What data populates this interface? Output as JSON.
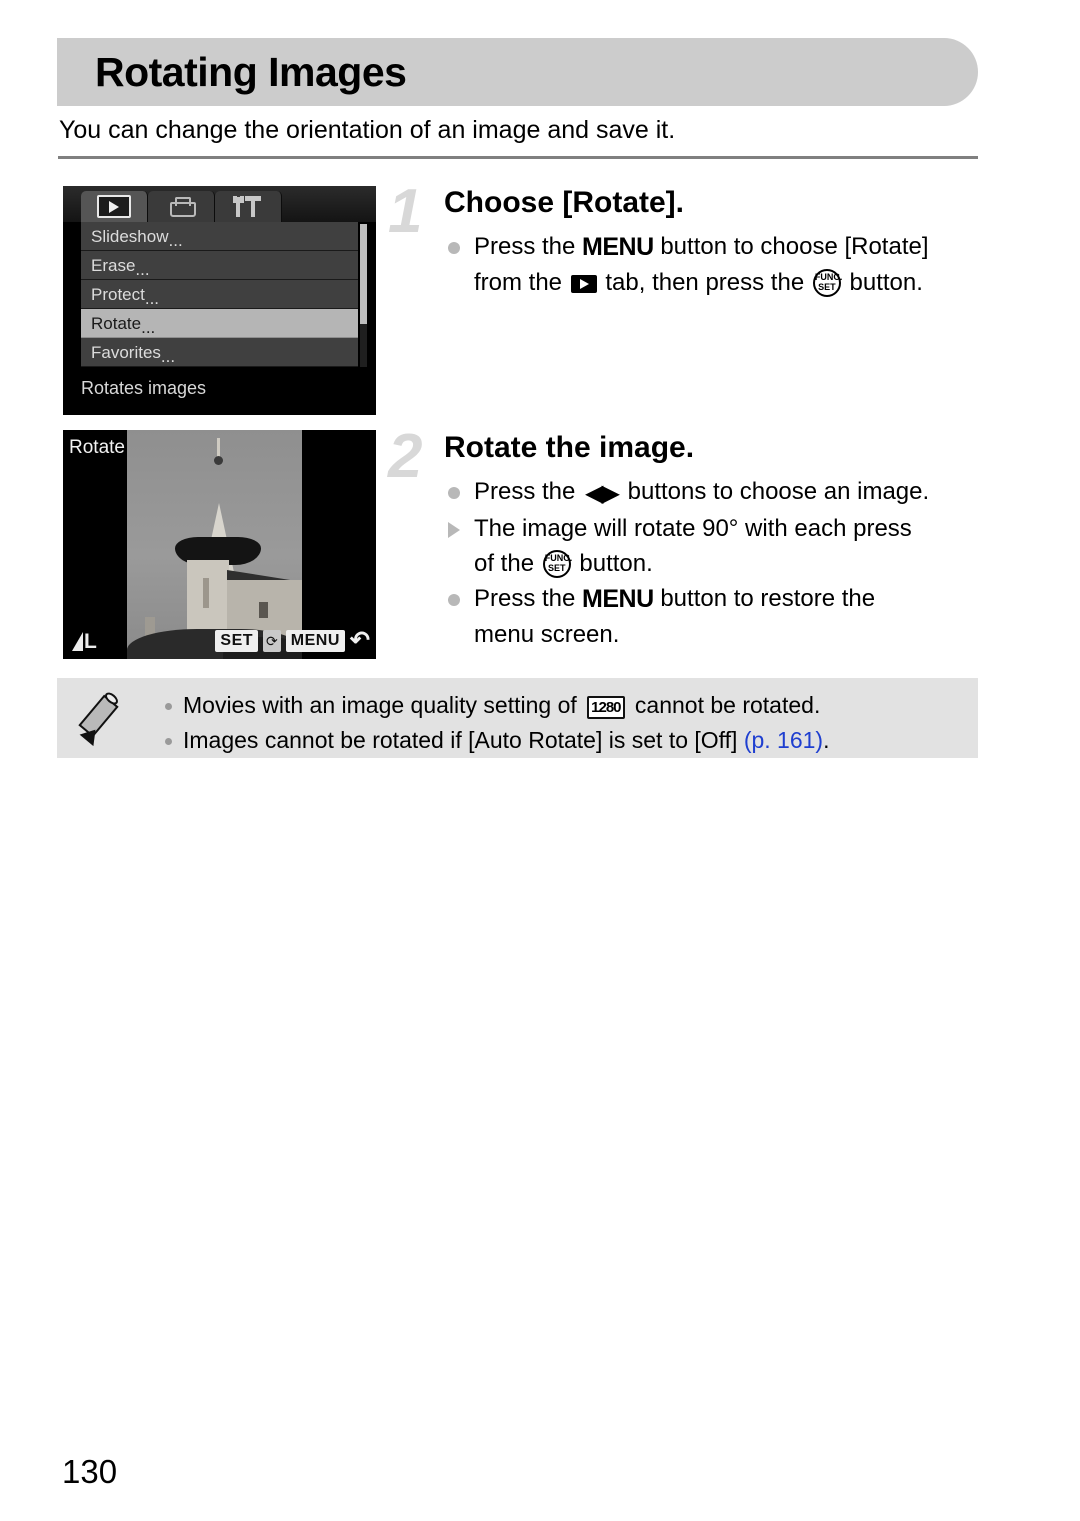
{
  "page": {
    "title": "Rotating Images",
    "intro": "You can change the orientation of an image and save it.",
    "number": "130"
  },
  "menu_screen": {
    "tabs": [
      {
        "name": "playback-tab",
        "icon": "play-icon",
        "active": true
      },
      {
        "name": "print-tab",
        "icon": "printer-icon",
        "active": false
      },
      {
        "name": "settings-tab",
        "icon": "tools-icon",
        "active": false
      }
    ],
    "items": [
      {
        "label": "Slideshow",
        "dots": "...",
        "selected": false
      },
      {
        "label": "Erase",
        "dots": "...",
        "selected": false
      },
      {
        "label": "Protect",
        "dots": "...",
        "selected": false
      },
      {
        "label": "Rotate",
        "dots": "...",
        "selected": true
      },
      {
        "label": "Favorites",
        "dots": "...",
        "selected": false
      }
    ],
    "hint": "Rotates images"
  },
  "rotate_screen": {
    "label": "Rotate",
    "quality": "L",
    "controls": {
      "set_key": "SET",
      "set_icon": "⟳",
      "menu_key": "MENU",
      "back_icon": "↶"
    }
  },
  "steps": [
    {
      "number": "1",
      "heading": "Choose [Rotate].",
      "lines": [
        {
          "type": "dot",
          "parts": [
            {
              "t": "text",
              "v": "Press the "
            },
            {
              "t": "glyph",
              "v": "MENU",
              "name": "menu-button-glyph"
            },
            {
              "t": "text",
              "v": " button to choose [Rotate]"
            }
          ]
        },
        {
          "type": "cont",
          "parts": [
            {
              "t": "text",
              "v": "from the "
            },
            {
              "t": "glyph",
              "v": "play",
              "name": "playback-tab-glyph"
            },
            {
              "t": "text",
              "v": " tab, then press the "
            },
            {
              "t": "glyph",
              "v": "FUNC SET",
              "name": "func-set-glyph"
            },
            {
              "t": "text",
              "v": " button."
            }
          ]
        }
      ]
    },
    {
      "number": "2",
      "heading": "Rotate the image.",
      "lines": [
        {
          "type": "dot",
          "parts": [
            {
              "t": "text",
              "v": "Press the "
            },
            {
              "t": "glyph",
              "v": "◀▶",
              "name": "left-right-buttons-glyph"
            },
            {
              "t": "text",
              "v": " buttons to choose an image."
            }
          ]
        },
        {
          "type": "tri",
          "parts": [
            {
              "t": "text",
              "v": "The image will rotate 90° with each press"
            }
          ]
        },
        {
          "type": "cont",
          "parts": [
            {
              "t": "text",
              "v": "of the "
            },
            {
              "t": "glyph",
              "v": "FUNC SET",
              "name": "func-set-glyph"
            },
            {
              "t": "text",
              "v": " button."
            }
          ]
        },
        {
          "type": "dot",
          "parts": [
            {
              "t": "text",
              "v": "Press the "
            },
            {
              "t": "glyph",
              "v": "MENU",
              "name": "menu-button-glyph"
            },
            {
              "t": "text",
              "v": " button to restore the"
            }
          ]
        },
        {
          "type": "cont",
          "parts": [
            {
              "t": "text",
              "v": "menu screen."
            }
          ]
        }
      ]
    }
  ],
  "note": {
    "icon": "pencil-icon",
    "items": [
      {
        "parts": [
          {
            "t": "text",
            "v": "Movies with an image quality setting of "
          },
          {
            "t": "glyph1280",
            "v": "1280"
          },
          {
            "t": "text",
            "v": " cannot be rotated."
          }
        ]
      },
      {
        "parts": [
          {
            "t": "text",
            "v": "Images cannot be rotated if [Auto Rotate] is set to [Off] "
          },
          {
            "t": "link",
            "v": "(p. 161)"
          },
          {
            "t": "text",
            "v": "."
          }
        ]
      }
    ]
  },
  "func_set_glyph": {
    "top": "FUNC.",
    "bottom": "SET"
  },
  "colors": {
    "title_bar": "#cccccc",
    "note_bg": "#e2e2e2",
    "link": "#1f3fd0",
    "step_number": "#d8d8d8",
    "bullet": "#b8b8b8"
  }
}
